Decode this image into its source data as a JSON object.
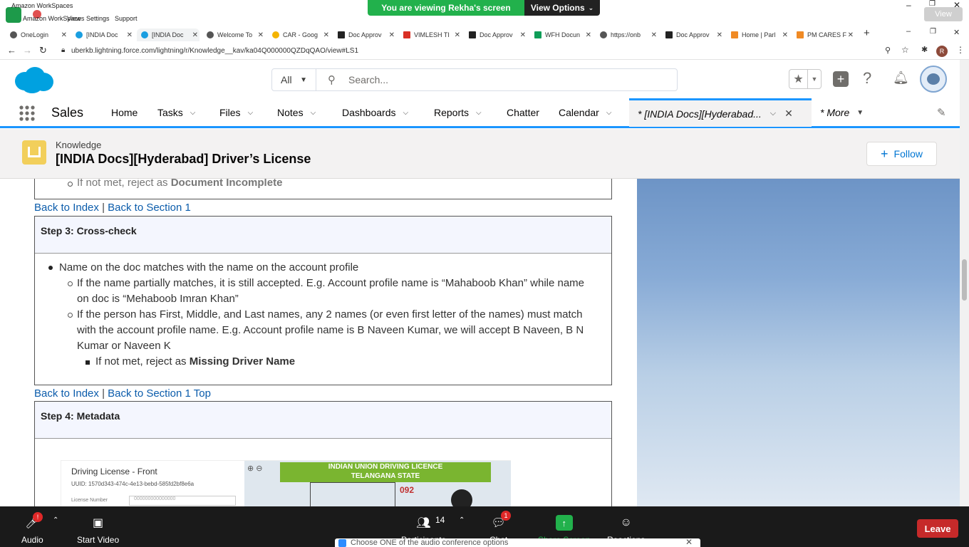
{
  "workspaces": {
    "title": "Amazon WorkSpaces",
    "menu": [
      "Amazon WorkSpaces",
      "View",
      "Settings",
      "Support"
    ],
    "share_banner": "You are viewing Rekha's screen",
    "view_options": "View Options",
    "view_btn": "View"
  },
  "tabs": [
    {
      "label": "OneLogin"
    },
    {
      "label": "[INDIA Doc"
    },
    {
      "label": "[INDIA Doc"
    },
    {
      "label": "Welcome To"
    },
    {
      "label": "CAR - Goog"
    },
    {
      "label": "Doc Approv"
    },
    {
      "label": "VIMLESH TI"
    },
    {
      "label": "Doc Approv"
    },
    {
      "label": "WFH Docun"
    },
    {
      "label": "https://onb"
    },
    {
      "label": "Doc Approv"
    },
    {
      "label": "Home | Parl"
    },
    {
      "label": "PM CARES F"
    }
  ],
  "address": {
    "url": "uberkb.lightning.force.com/lightning/r/Knowledge__kav/ka04Q000000QZDqQAO/view#LS1",
    "avatar_letter": "R"
  },
  "search": {
    "scope": "All",
    "placeholder": "Search..."
  },
  "nav": {
    "app": "Sales",
    "items": [
      "Home",
      "Tasks",
      "Files",
      "Notes",
      "Dashboards",
      "Reports",
      "Chatter",
      "Calendar"
    ],
    "active_tab": "* [INDIA Docs][Hyderabad...",
    "more": "* More"
  },
  "record": {
    "type": "Knowledge",
    "title": "[INDIA Docs][Hyderabad] Driver’s License",
    "follow": "Follow"
  },
  "content": {
    "prev_line_a": "If not met, reject as ",
    "prev_line_b": "Document Incomplete",
    "link_index": "Back to Index",
    "sep": "|",
    "link_section1": "Back to Section 1",
    "link_section1_top": "Back to Section 1 Top",
    "step3_title": "Step 3: Cross-check",
    "b1": "Name on the doc matches with the name on the account profile",
    "b1a_l1": "If the name partially matches, it is still accepted. E.g. Account profile name is “Mahaboob Khan” while name",
    "b1a_l2": "on doc is “Mehaboob Imran Khan”",
    "b1b_l1": "If the person has First, Middle, and Last names, any 2 names (or even first letter of the names) must match",
    "b1b_l2": "with the account profile name. E.g. Account profile name is B Naveen Kumar, we will accept B Naveen, B N",
    "b1b_l3": "Kumar or Naveen K",
    "b1b_i_a": "If not met, reject as ",
    "b1b_i_b": "Missing Driver Name",
    "step4_title": "Step 4: Metadata",
    "img_label": "Driving License - Front",
    "img_uuid": "UUID: 1570d343-474c-4e13-bebd-585fd2bf8e6a",
    "img_field": "License Number",
    "img_field_value": "000000000000000",
    "img_card_line1": "INDIAN UNION DRIVING LICENCE",
    "img_card_line2": "TELANGANA STATE",
    "img_card_num": "092"
  },
  "zoom": {
    "audio": "Audio",
    "start_video": "Start Video",
    "participants": "Participants",
    "participants_count": "14",
    "chat": "Chat",
    "chat_badge": "1",
    "audio_badge": "!",
    "share_screen": "Share Screen",
    "reactions": "Reactions",
    "leave": "Leave",
    "popup": "Choose ONE of the audio conference options"
  },
  "colors": {
    "sf_blue": "#0176d3",
    "nav_accent": "#1b96ff",
    "knowledge_icon": "#f2cf5b",
    "zoom_green": "#22b14c",
    "leave_red": "#c62a2a"
  }
}
